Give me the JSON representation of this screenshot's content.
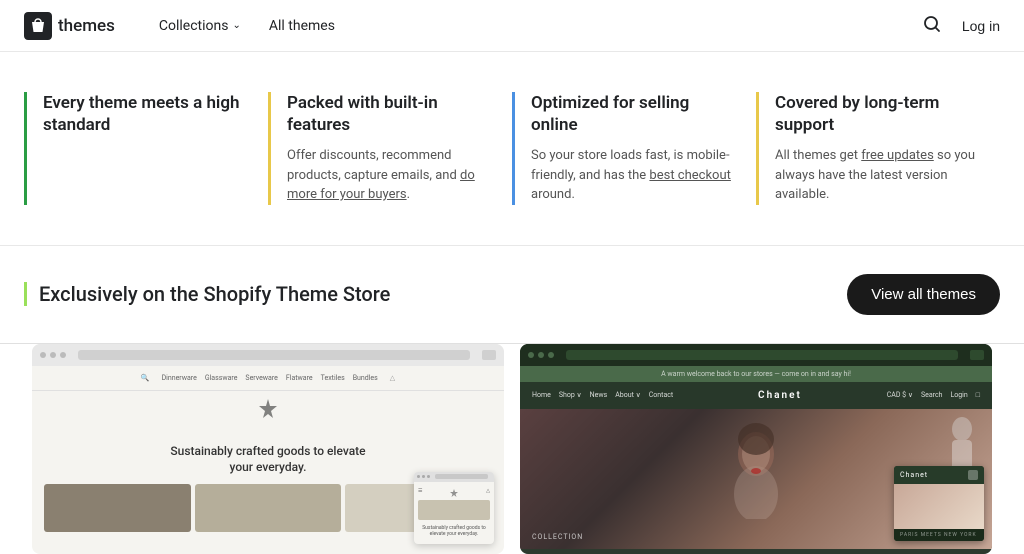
{
  "nav": {
    "logo_text": "themes",
    "collections_label": "Collections",
    "all_themes_label": "All themes",
    "search_aria": "Search",
    "login_label": "Log in"
  },
  "features": [
    {
      "id": "standard",
      "title": "Every theme meets a high standard",
      "desc": "",
      "border_color": "#2a9d44"
    },
    {
      "id": "builtin",
      "title": "Packed with built-in features",
      "desc": "Offer discounts, recommend products, capture emails, and do more for your buyers.",
      "link_text": "do more for your buyers",
      "border_color": "#e8c84a"
    },
    {
      "id": "selling",
      "title": "Optimized for selling online",
      "desc": "So your store loads fast, is mobile-friendly, and has the best checkout around.",
      "link_text": "best checkout",
      "border_color": "#4a90e2"
    },
    {
      "id": "support",
      "title": "Covered by long-term support",
      "desc": "All themes get free updates so you always have the latest version available.",
      "link_text": "free updates",
      "border_color": "#e8c84a"
    }
  ],
  "exclusive": {
    "title": "Exclusively on the Shopify Theme Store",
    "view_all_label": "View all themes"
  },
  "themes": [
    {
      "id": "theme-left",
      "headline": "Sustainably crafted goods to elevate your everyday.",
      "nav_items": [
        "Dinnerware",
        "Glassware",
        "Serveware",
        "Flatware",
        "Textiles",
        "Bundles"
      ]
    },
    {
      "id": "theme-right",
      "name": "Chanet",
      "nav_items": [
        "Home",
        "Shop",
        "News",
        "About",
        "Contact"
      ],
      "collection_label": "COLLECTION",
      "tagline": "Paris Meets New York"
    }
  ]
}
